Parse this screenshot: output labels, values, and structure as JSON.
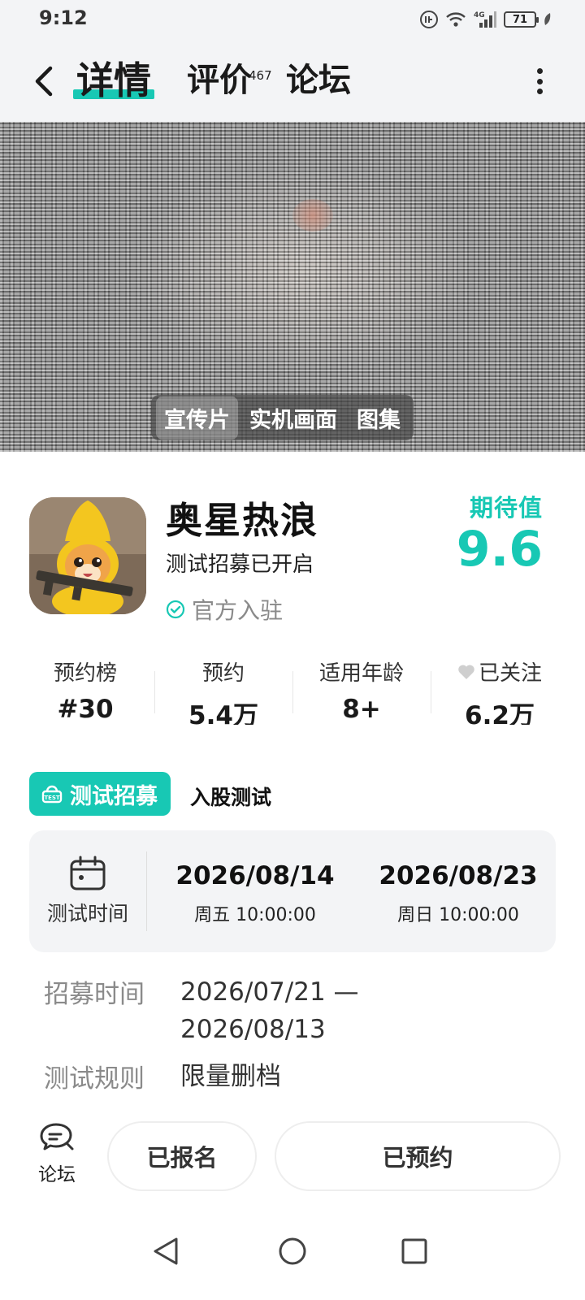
{
  "status_bar": {
    "time": "9:12",
    "battery": "71",
    "network": "4G"
  },
  "nav": {
    "tabs": [
      {
        "label": "详情",
        "active": true
      },
      {
        "label": "评价",
        "badge": "467"
      },
      {
        "label": "论坛"
      }
    ]
  },
  "media": {
    "tabs": [
      "宣传片",
      "实机画面",
      "图集"
    ],
    "active_tab": "宣传片"
  },
  "game": {
    "title": "奥星热浪",
    "subtitle": "测试招募已开启",
    "official_label": "官方入驻",
    "expect_label": "期待值",
    "expect_value": "9.6"
  },
  "stats": [
    {
      "label": "预约榜",
      "value": "#30"
    },
    {
      "label": "预约",
      "value": "5.4万"
    },
    {
      "label": "适用年龄",
      "value": "8+"
    },
    {
      "label": "已关注",
      "value": "6.2万"
    }
  ],
  "test": {
    "badge_label": "测试招募",
    "type": "入股测试",
    "time_label": "测试时间",
    "start_date": "2026/08/14",
    "start_time": "周五  10:00:00",
    "end_date": "2026/08/23",
    "end_time": "周日  10:00:00",
    "recruit_label": "招募时间",
    "recruit_line1": "2026/07/21 —",
    "recruit_line2": "2026/08/13",
    "rule_label": "测试规则",
    "rule_value": "限量删档"
  },
  "actions": {
    "forum_label": "论坛",
    "signed_label": "已报名",
    "reserved_label": "已预约"
  },
  "colors": {
    "accent": "#18c8b4",
    "card_bg": "#f3f4f6"
  }
}
